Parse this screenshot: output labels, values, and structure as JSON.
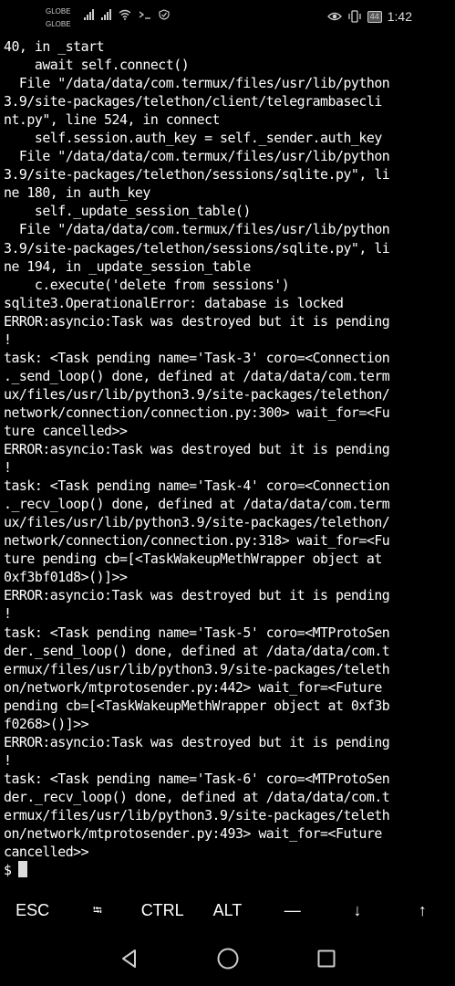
{
  "status_bar": {
    "carrier_1": "GLOBE",
    "carrier_2": "GLOBE",
    "battery": "44",
    "time": "1:42"
  },
  "terminal": {
    "lines": [
      "40, in _start",
      "    await self.connect()",
      "  File \"/data/data/com.termux/files/usr/lib/python",
      "3.9/site-packages/telethon/client/telegrambasecli",
      "nt.py\", line 524, in connect",
      "    self.session.auth_key = self._sender.auth_key",
      "  File \"/data/data/com.termux/files/usr/lib/python",
      "3.9/site-packages/telethon/sessions/sqlite.py\", li",
      "ne 180, in auth_key",
      "    self._update_session_table()",
      "  File \"/data/data/com.termux/files/usr/lib/python",
      "3.9/site-packages/telethon/sessions/sqlite.py\", li",
      "ne 194, in _update_session_table",
      "    c.execute('delete from sessions')",
      "sqlite3.OperationalError: database is locked",
      "ERROR:asyncio:Task was destroyed but it is pending",
      "!",
      "task: <Task pending name='Task-3' coro=<Connection",
      "._send_loop() done, defined at /data/data/com.term",
      "ux/files/usr/lib/python3.9/site-packages/telethon/",
      "network/connection/connection.py:300> wait_for=<Fu",
      "ture cancelled>>",
      "ERROR:asyncio:Task was destroyed but it is pending",
      "!",
      "task: <Task pending name='Task-4' coro=<Connection",
      "._recv_loop() done, defined at /data/data/com.term",
      "ux/files/usr/lib/python3.9/site-packages/telethon/",
      "network/connection/connection.py:318> wait_for=<Fu",
      "ture pending cb=[<TaskWakeupMethWrapper object at",
      "0xf3bf01d8>()]>>",
      "ERROR:asyncio:Task was destroyed but it is pending",
      "!",
      "task: <Task pending name='Task-5' coro=<MTProtoSen",
      "der._send_loop() done, defined at /data/data/com.t",
      "ermux/files/usr/lib/python3.9/site-packages/teleth",
      "on/network/mtprotosender.py:442> wait_for=<Future",
      "pending cb=[<TaskWakeupMethWrapper object at 0xf3b",
      "f0268>()]>>",
      "ERROR:asyncio:Task was destroyed but it is pending",
      "!",
      "task: <Task pending name='Task-6' coro=<MTProtoSen",
      "der._recv_loop() done, defined at /data/data/com.t",
      "ermux/files/usr/lib/python3.9/site-packages/teleth",
      "on/network/mtprotosender.py:493> wait_for=<Future",
      "cancelled>>"
    ],
    "prompt": "$"
  },
  "extra_keys": [
    "ESC",
    "⭾",
    "CTRL",
    "ALT",
    "—",
    "↓",
    "↑"
  ],
  "nav_bar": {
    "icons": [
      "back-icon",
      "home-icon",
      "recents-icon"
    ]
  }
}
